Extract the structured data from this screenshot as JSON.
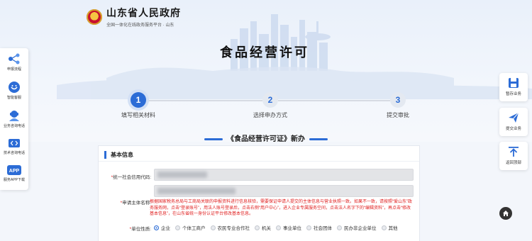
{
  "header": {
    "site_name": "山东省人民政府",
    "site_sub": "全国一体化在线政务服务平台 · 山东",
    "page_title": "食品经营许可"
  },
  "steps": [
    {
      "number": "1",
      "label": "填写相关材料",
      "active": true
    },
    {
      "number": "2",
      "label": "选择申办方式",
      "active": false
    },
    {
      "number": "3",
      "label": "提交审批",
      "active": false
    }
  ],
  "form_heading": "《食品经营许可证》新办",
  "form": {
    "section_title": "基本信息",
    "credit_code_label": "统一社会信用代码:",
    "entity_name_label": "申请主体名称:",
    "notice": "根据国家税务总局与工商局关联的申报资料进行信息核验，需要保证申请人提交的主体信息与营业执照一致。如果不一致，请按照“爱山东”政务服务网，点击“登录账号”，用法人账号登录后，点击右侧“用户中心”，进入企业专属服务空间，点击法人名字下的“编辑资料”，再点击“修改基本信息”，在山东省统一身份认证平台修改基本信息。",
    "unit_nature_label": "单位性质:",
    "unit_nature_options": [
      "企业",
      "个体工商户",
      "农民专业合作社",
      "机关",
      "事业单位",
      "社会团体",
      "民办非企业单位",
      "其他"
    ],
    "unit_nature_selected": "企业"
  },
  "left_nav": [
    {
      "icon": "flow-icon",
      "label": "申报流程"
    },
    {
      "icon": "assistant-icon",
      "label": "智能客服"
    },
    {
      "icon": "consult-icon",
      "label": "业务咨询电话"
    },
    {
      "icon": "code-icon",
      "label": "技术咨询电话"
    },
    {
      "icon": "app-icon",
      "label": "服务APP下载",
      "badge": "APP"
    }
  ],
  "right_nav": [
    {
      "icon": "save-icon",
      "label": "暂存业务"
    },
    {
      "icon": "send-icon",
      "label": "提交业务"
    },
    {
      "icon": "back-to-top-icon",
      "label": "返回顶部"
    }
  ],
  "colors": {
    "accent": "#2c6cd6",
    "warning": "#e02020"
  }
}
